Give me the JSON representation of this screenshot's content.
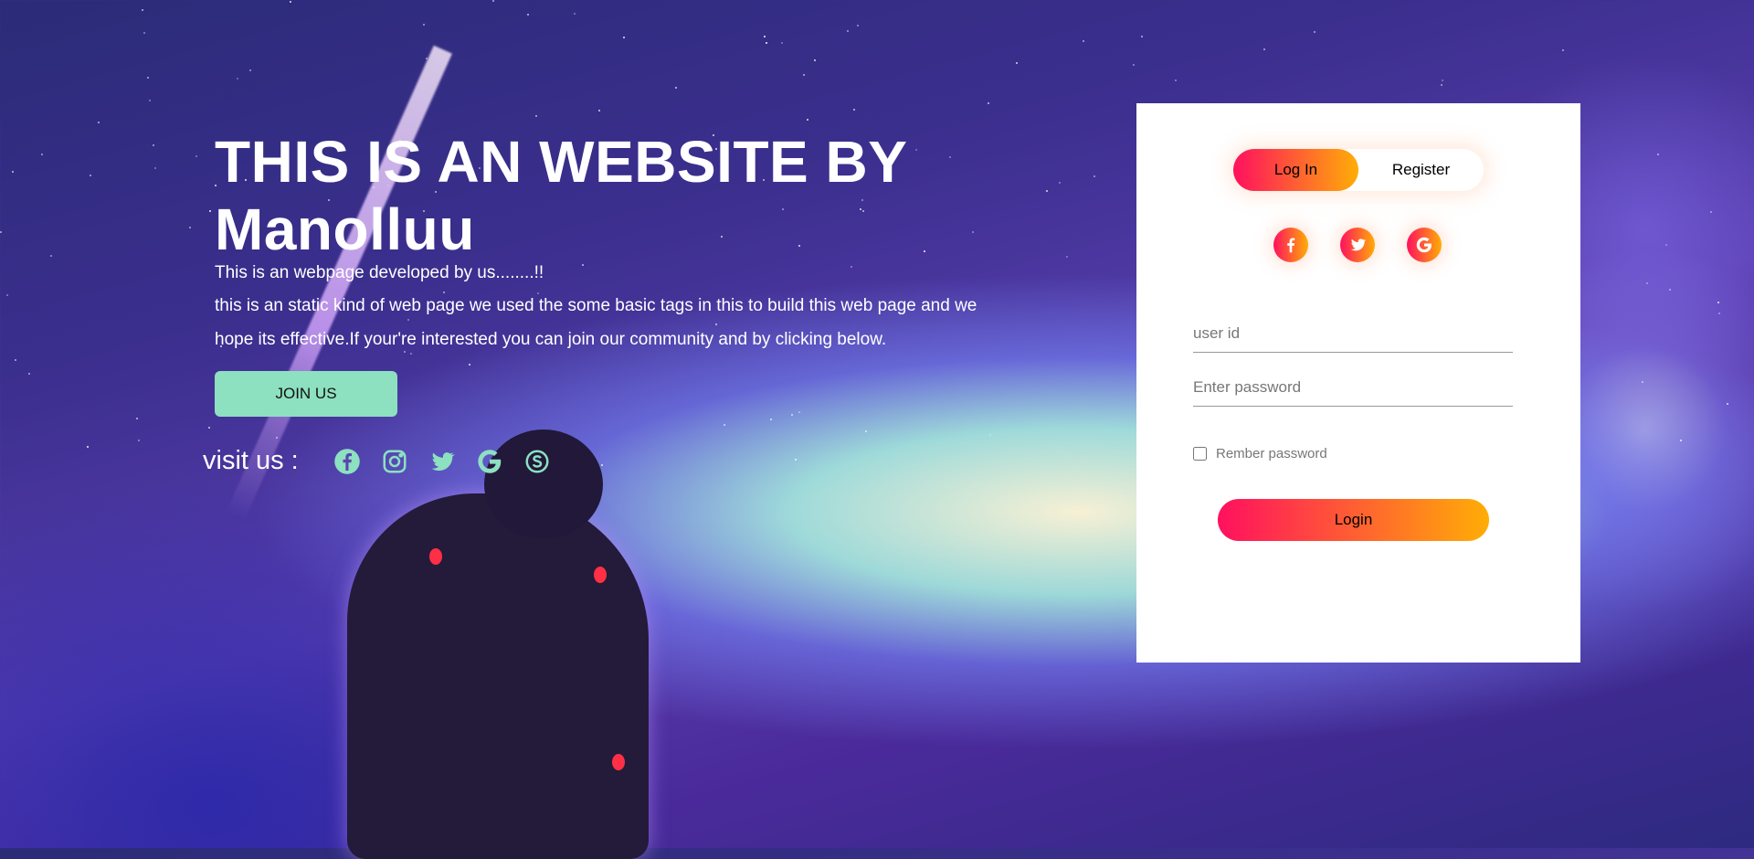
{
  "hero": {
    "title_line1": "THIS IS AN WEBSITE BY",
    "title_line2": "Manolluu",
    "intro": "This is an webpage developed by us........!!",
    "description": "this is an static kind of web page we used the some basic tags in this to build this web page and we hope its effective.If your're interested you can join our community and by clicking below.",
    "join_button": "JOIN US",
    "visit_label": "visit us :",
    "visit_icons": [
      "facebook-icon",
      "instagram-icon",
      "twitter-icon",
      "google-icon",
      "skype-icon"
    ],
    "icon_color": "#8de0c0"
  },
  "login_card": {
    "tabs": [
      "Log In",
      "Register"
    ],
    "active_tab": "Log In",
    "social_icons": [
      "facebook-icon",
      "twitter-icon",
      "google-icon"
    ],
    "user_placeholder": "user id",
    "password_placeholder": "Enter password",
    "remember_label": "Rember password",
    "remember_checked": false,
    "login_button": "Login",
    "accent_gradient": [
      "#ff105f",
      "#ffad06"
    ]
  }
}
